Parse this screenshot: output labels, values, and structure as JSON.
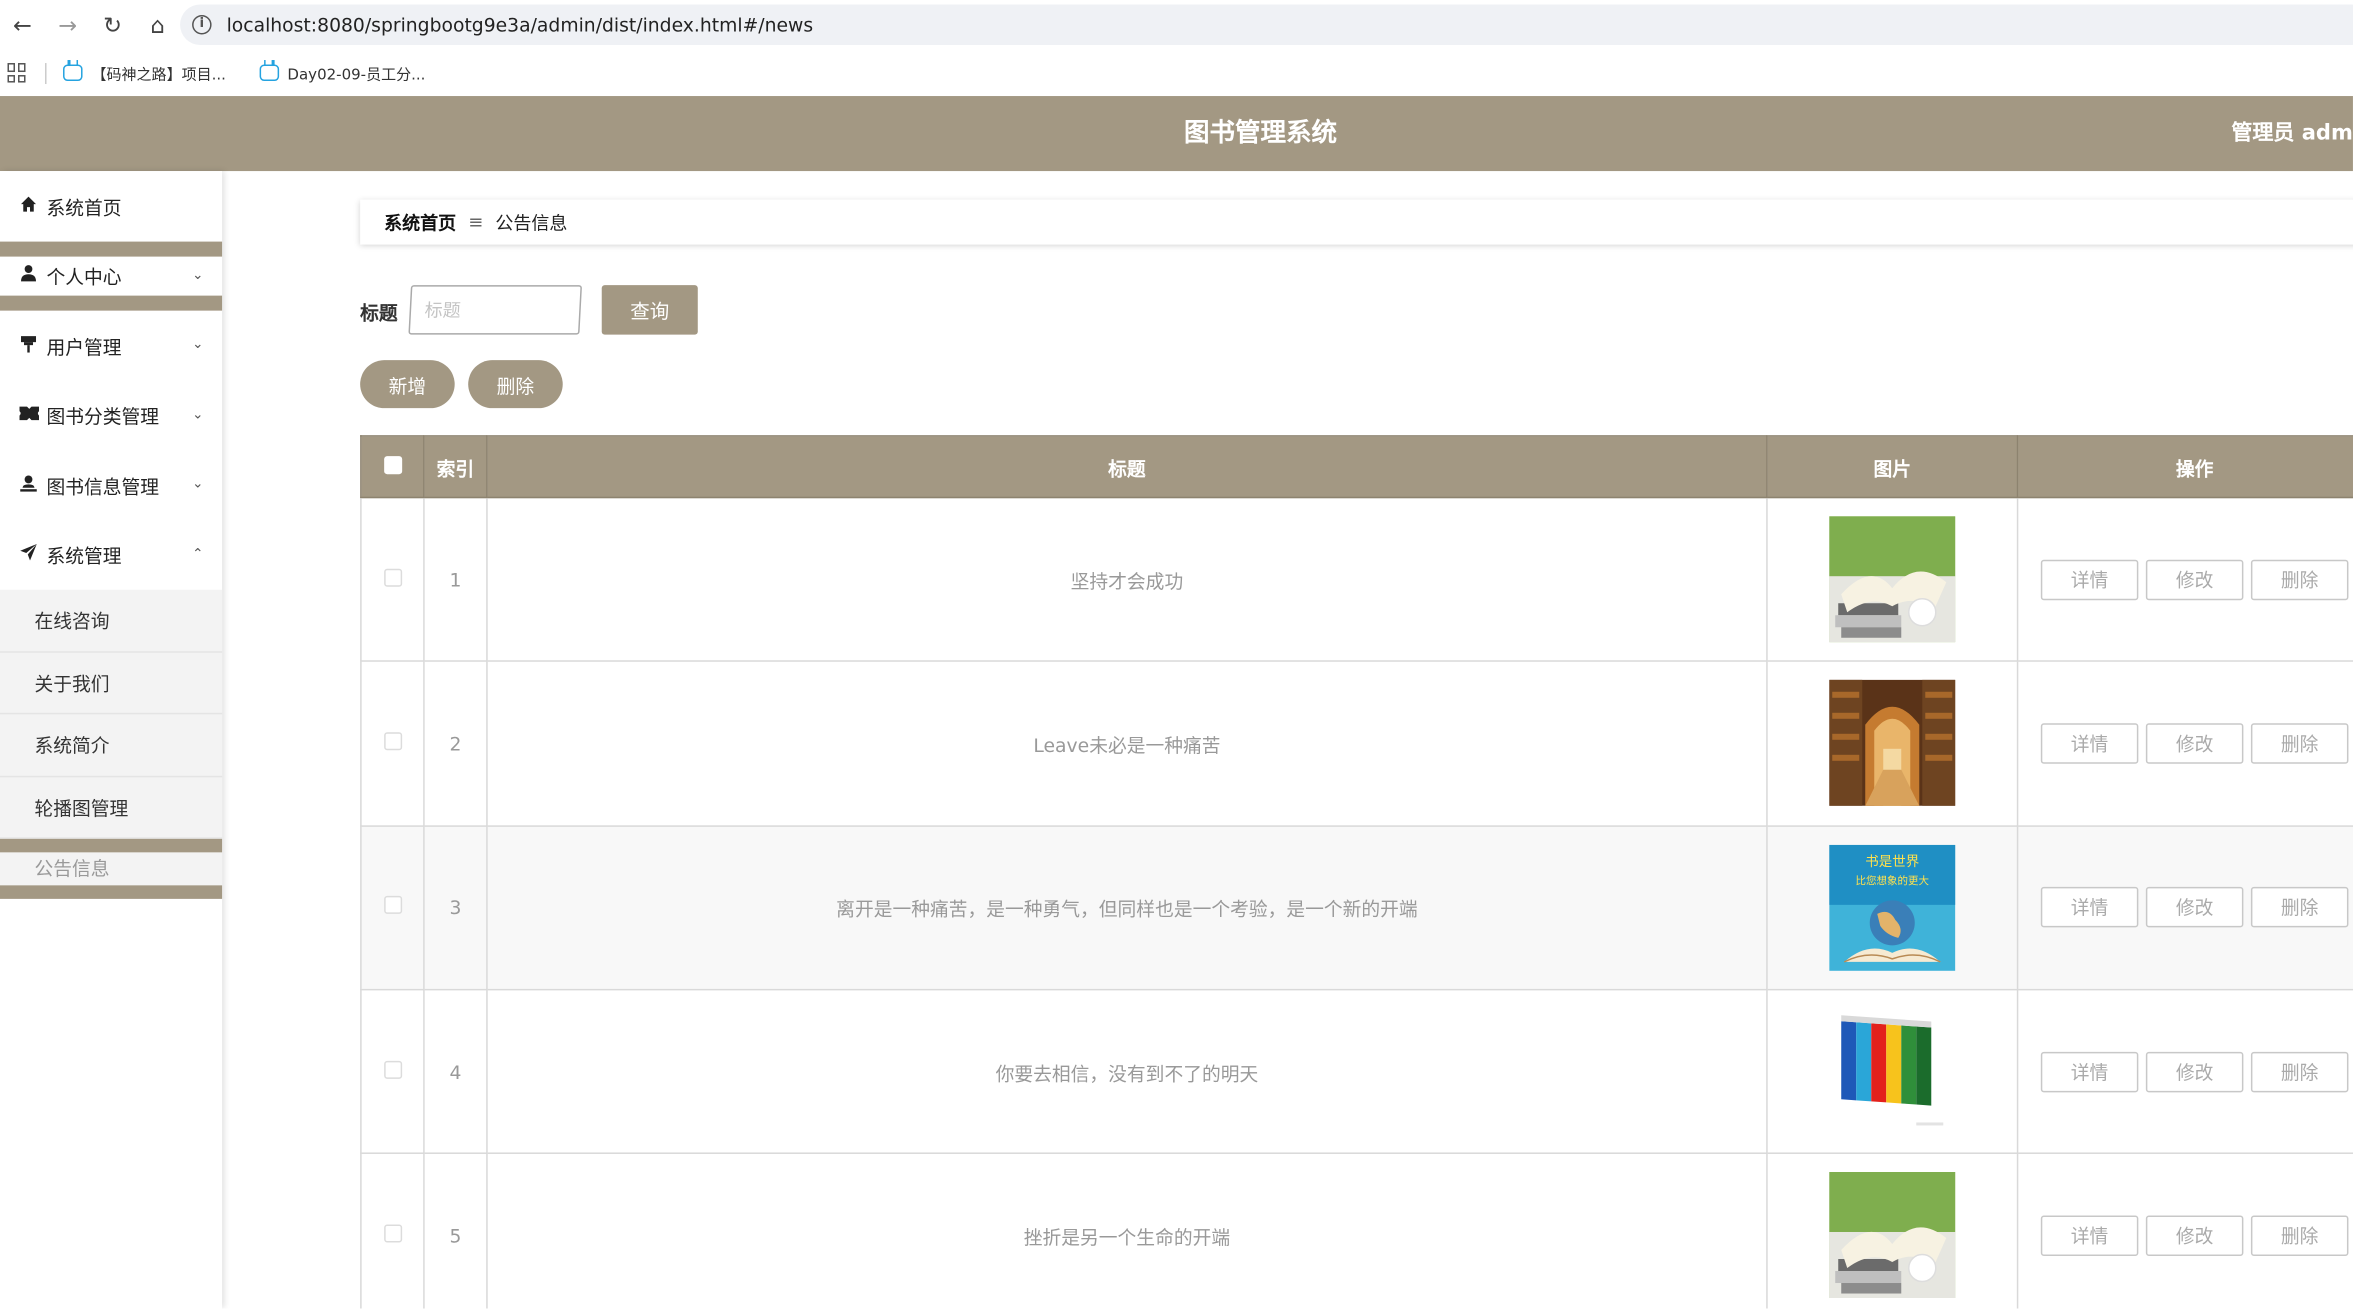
{
  "browser": {
    "url_host": "localhost",
    "url_path": ":8080/springbootg9e3a/admin/dist/index.html#/news",
    "bookmarks": [
      "【码神之路】项目...",
      "Day02-09-员工分..."
    ]
  },
  "header": {
    "title": "图书管理系统",
    "user": "管理员 admin"
  },
  "sidebar": {
    "items": [
      {
        "label": "系统首页",
        "icon": "home-icon",
        "has_chevron": false
      },
      {
        "label": "个人中心",
        "icon": "user-icon",
        "has_chevron": true
      },
      {
        "label": "用户管理",
        "icon": "pin-icon",
        "has_chevron": true
      },
      {
        "label": "图书分类管理",
        "icon": "ticket-icon",
        "has_chevron": true
      },
      {
        "label": "图书信息管理",
        "icon": "person-icon",
        "has_chevron": true
      },
      {
        "label": "系统管理",
        "icon": "send-icon",
        "has_chevron": true
      }
    ],
    "submenu": [
      "在线咨询",
      "关于我们",
      "系统简介",
      "轮播图管理",
      "公告信息"
    ]
  },
  "breadcrumb": {
    "home": "系统首页",
    "current": "公告信息"
  },
  "search": {
    "label": "标题",
    "placeholder": "标题",
    "button": "查询"
  },
  "actions": {
    "add": "新增",
    "delete": "删除"
  },
  "table": {
    "headers": {
      "index": "索引",
      "title": "标题",
      "image": "图片",
      "ops": "操作"
    },
    "op_labels": {
      "detail": "详情",
      "edit": "修改",
      "delete": "删除"
    },
    "rows": [
      {
        "index": "1",
        "title": "坚持才会成功",
        "image": "open-book-photo"
      },
      {
        "index": "2",
        "title": "Leave未必是一种痛苦",
        "image": "library-photo"
      },
      {
        "index": "3",
        "title": "离开是一种痛苦，是一种勇气，但同样也是一个考验，是一个新的开端",
        "image": "globe-book-poster"
      },
      {
        "index": "4",
        "title": "你要去相信，没有到不了的明天",
        "image": "colored-books-photo"
      },
      {
        "index": "5",
        "title": "挫折是另一个生命的开端",
        "image": "open-book-photo"
      }
    ]
  },
  "poster_text": {
    "line1": "书是世界",
    "line2": "比您想象的更大"
  },
  "colors": {
    "brand": "#a39883",
    "brand_border": "#8d836f"
  }
}
